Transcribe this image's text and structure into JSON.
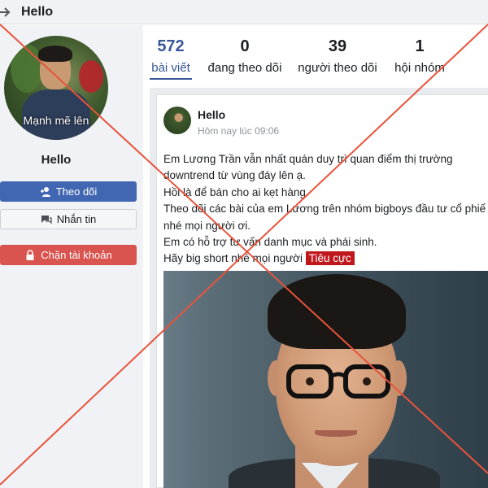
{
  "header": {
    "title": "Hello"
  },
  "profile": {
    "avatar_caption": "Mạnh mẽ lên",
    "name": "Hello",
    "follow_label": "Theo dõi",
    "message_label": "Nhắn tin",
    "block_label": "Chặn tài khoản"
  },
  "stats": [
    {
      "value": "572",
      "label": "bài viết"
    },
    {
      "value": "0",
      "label": "đang theo dõi"
    },
    {
      "value": "39",
      "label": "người theo dõi"
    },
    {
      "value": "1",
      "label": "hội nhóm"
    }
  ],
  "post": {
    "author": "Hello",
    "time": "Hôm nay lúc 09:06",
    "lines": [
      "Em Lương Trần vẫn nhất quán duy trì quan điểm thị trường",
      "downtrend từ vùng đáy lên ạ.",
      "Hồi là để bán cho ai kẹt hàng.",
      "Theo dõi các bài của em Lương trên nhóm bigboys đầu tư cổ phiế",
      "nhé mọi người ơi.",
      "Em có hỗ trợ tư vấn danh mục và phái sinh.",
      "Hãy big short nhé mọi người"
    ],
    "tag": "Tiêu cực"
  },
  "colors": {
    "accent": "#385898",
    "follow_button": "#4267b2",
    "block_button": "#d9534f",
    "tag": "#c0171d",
    "cross_overlay": "#e8533b"
  }
}
